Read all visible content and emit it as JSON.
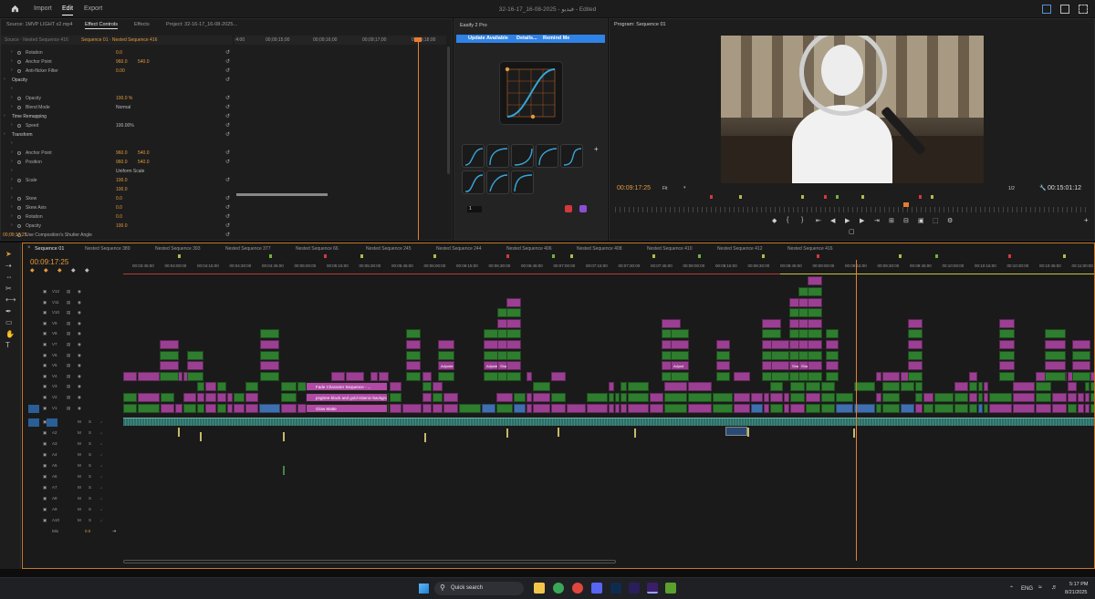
{
  "topbar": {
    "home_icon": "home-icon",
    "nav": [
      "Import",
      "Edit",
      "Export"
    ],
    "active": "Edit",
    "title": "32-16-17_16-08-2025 - فيديو - Edited",
    "right_icons": [
      "workspaces-icon",
      "quick-export-icon",
      "fullscreen-icon"
    ]
  },
  "source_panel": {
    "tabs": [
      "Source: 1MVP LIGHT x2.mp4",
      "Effect Controls",
      "Effects",
      "Project: 32-16-17_16-08-2025..."
    ],
    "active_tab": "Effect Controls",
    "source_label": "Source · Nested Sequence 416",
    "sequence_label": "Sequence 01 · Nested Sequence 416",
    "ruler_times": [
      ":4:00",
      "00;09;15;00",
      "00;09;16;00",
      "00;09;17;00",
      "00;09;18;00",
      "00;09;19;00"
    ],
    "timecode": "00;09;17;25",
    "rows": [
      {
        "label": "Rotation",
        "v1": "0.0",
        "v2": ""
      },
      {
        "label": "Anchor Point",
        "v1": "960.0",
        "v2": "540.0"
      },
      {
        "label": "Anti-flicker Filter",
        "v1": "0.00",
        "v2": ""
      },
      {
        "label": "Opacity",
        "v1": "",
        "v2": ""
      },
      {
        "label": "",
        "v1": "",
        "v2": ""
      },
      {
        "label": "Opacity",
        "v1": "100.0 %",
        "v2": ""
      },
      {
        "label": "Blend Mode",
        "v1": "Normal",
        "v2": ""
      },
      {
        "label": "Time Remapping",
        "v1": "",
        "v2": ""
      },
      {
        "label": "Speed",
        "v1": "100.00%",
        "v2": ""
      },
      {
        "label": "Transform",
        "v1": "",
        "v2": ""
      },
      {
        "label": "",
        "v1": "",
        "v2": ""
      },
      {
        "label": "Anchor Point",
        "v1": "960.0",
        "v2": "540.0"
      },
      {
        "label": "Position",
        "v1": "960.0",
        "v2": "540.0"
      },
      {
        "label": "",
        "v1": "Uniform Scale",
        "v2": ""
      },
      {
        "label": "Scale",
        "v1": "100.0",
        "v2": ""
      },
      {
        "label": "",
        "v1": "100.0",
        "v2": ""
      },
      {
        "label": "Skew",
        "v1": "0.0",
        "v2": ""
      },
      {
        "label": "Skew Axis",
        "v1": "0.0",
        "v2": ""
      },
      {
        "label": "Rotation",
        "v1": "0.0",
        "v2": ""
      },
      {
        "label": "Opacity",
        "v1": "100.0",
        "v2": ""
      },
      {
        "label": "Use Composition's Shutter Angle",
        "v1": "",
        "v2": ""
      }
    ]
  },
  "eases_panel": {
    "title": "Easify 2 Pro",
    "banner_text": "Update Available",
    "details_label": "Details...",
    "remind_label": "Remind Me",
    "value_field": "1",
    "presets": 8
  },
  "program_panel": {
    "title": "Program: Sequence 01",
    "timecode_left": "00:09:17:25",
    "zoom": "Fit",
    "quality": "1/2",
    "timecode_right": "00:15:01:12"
  },
  "timeline": {
    "sequence_tab": "Sequence 01",
    "timecode": "00:09:17:25",
    "nested_labels": [
      "Nested Sequence 389",
      "Nested Sequence 393",
      "Nested Sequence 377",
      "Nested Sequence 66",
      "Nested Sequence 245",
      "Nested Sequence 244",
      "Nested Sequence 406",
      "Nested Sequence 408",
      "Nested Sequence 410",
      "Nested Sequence 412",
      "Nested Sequence 416"
    ],
    "ruler_times": [
      "00:03:45:00",
      "00:04:00:00",
      "00:04:15:00",
      "00:04:30:00",
      "00:04:45:00",
      "00:05:00:00",
      "00:05:15:00",
      "00:05:30:00",
      "00:05:45:00",
      "00:06:00:00",
      "00:06:15:00",
      "00:06:30:00",
      "00:06:45:00",
      "00:07:00:00",
      "00:07:15:00",
      "00:07:30:00",
      "00:07:45:00",
      "00:08:00:00",
      "00:08:15:00",
      "00:08:30:00",
      "00:08:45:00",
      "00:09:00:00",
      "00:09:15:00",
      "00:09:30:00",
      "00:09:45:00",
      "00:10:00:00",
      "00:10:15:00",
      "00:10:30:00",
      "00:10:45:00",
      "00:11:00:00"
    ],
    "video_tracks": [
      "V12",
      "V11",
      "V10",
      "V9",
      "V8",
      "V7",
      "V6",
      "V5",
      "V4",
      "V3",
      "V2",
      "V1"
    ],
    "audio_tracks": [
      "A1",
      "A2",
      "A3",
      "A4",
      "A5",
      "A6",
      "A7",
      "A8",
      "A9",
      "A10"
    ],
    "mix_label": "Mix",
    "mix_value": "0.0",
    "clip_labels": [
      "Fade Character Sequence - ...",
      "pngtree-black and gold-islamic-backgrou",
      "Glow Matte",
      "Adjustm",
      "Adjustment",
      "Shadows Sno",
      "Pattern Glo",
      "Adjust",
      "Adjustm",
      "Color Wor",
      "Adjust",
      "Shadow",
      "Shadow"
    ]
  },
  "taskbar": {
    "search_placeholder": "Quick search",
    "lang": "ENG",
    "time": "5:17 PM",
    "date": "8/21/2025"
  },
  "colors": {
    "accent_orange": "#e39a3c",
    "clip_pink": "#9b3f92",
    "clip_green": "#2f7d2f",
    "clip_blue": "#3f6fae",
    "playhead": "#e87d2f",
    "banner_blue": "#2f82e6"
  }
}
